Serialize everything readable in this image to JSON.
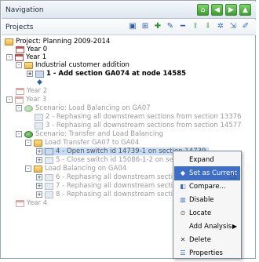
{
  "navigation": {
    "title": "Navigation",
    "buttons": [
      "home-icon",
      "back-icon",
      "forward-icon",
      "up-icon"
    ]
  },
  "projects": {
    "title": "Projects",
    "toolbar_icons": [
      "save-icon",
      "grid-icon",
      "add-icon",
      "edit-icon",
      "remove-icon",
      "move-up-icon",
      "move-down-icon",
      "settings-icon",
      "export-icon",
      "pin-icon"
    ]
  },
  "tree": [
    {
      "label": "Project: Planning 2009-2014",
      "expander": "",
      "icon": "folder"
    },
    {
      "label": "Year 0",
      "expander": "",
      "icon": "calendar"
    },
    {
      "label": "Year 1",
      "expander": "-",
      "icon": "calendar"
    },
    {
      "label": "Industrial customer addition",
      "expander": "-",
      "icon": "folder"
    },
    {
      "label": "1 - Add section GA074 at node 14585",
      "expander": "+",
      "icon": "document"
    },
    {
      "label": "",
      "expander": "",
      "icon": "node"
    },
    {
      "label": "Year 2",
      "expander": "",
      "icon": "calendar"
    },
    {
      "label": "Year 3",
      "expander": "-",
      "icon": "calendar"
    },
    {
      "label": "Scenario: Load Balancing on GA07",
      "expander": "-",
      "icon": "scenario"
    },
    {
      "label": "2 - Rephasing all downstream sections from section 13376",
      "expander": "",
      "icon": "document"
    },
    {
      "label": "3 - Rephasing all downstream sections from section 14577",
      "expander": "",
      "icon": "document"
    },
    {
      "label": "Scenario: Transfer and Load Balancing",
      "expander": "-",
      "icon": "scenario"
    },
    {
      "label": "Load Transfer GA07 to GA04",
      "expander": "-",
      "icon": "folder"
    },
    {
      "label": "4 - Open switch id 14739-1 on section 14739",
      "expander": "+",
      "icon": "document"
    },
    {
      "label": "5 - Close switch id 15086-1-2 on section 15",
      "expander": "+",
      "icon": "document"
    },
    {
      "label": "Load Balancing on GA04",
      "expander": "-",
      "icon": "folder"
    },
    {
      "label": "6 - Rephasing all downstream sections from",
      "expander": "+",
      "icon": "document"
    },
    {
      "label": "7 - Rephasing all downstream sections from",
      "expander": "+",
      "icon": "document"
    },
    {
      "label": "8 - Rephasing all downstream sections from",
      "expander": "+",
      "icon": "document"
    },
    {
      "label": "Year 4",
      "expander": "",
      "icon": "calendar"
    }
  ],
  "context_menu": {
    "items": [
      {
        "label": "Expand",
        "icon": ""
      },
      {
        "label": "Set as Current",
        "icon": "set-current-icon",
        "highlighted": true
      },
      {
        "label": "Compare...",
        "icon": "compare-icon"
      },
      {
        "label": "Disable",
        "icon": "disable-icon"
      },
      {
        "label": "Locate",
        "icon": "locate-icon"
      },
      {
        "label": "Add Analysis",
        "icon": "",
        "submenu": true
      },
      {
        "label": "Delete",
        "icon": "delete-icon"
      },
      {
        "label": "Properties",
        "icon": "properties-icon"
      }
    ]
  },
  "colors": {
    "highlight": "#3f6fc4",
    "selection": "#c7dcf5",
    "disabled_text": "#9a9a9a"
  }
}
